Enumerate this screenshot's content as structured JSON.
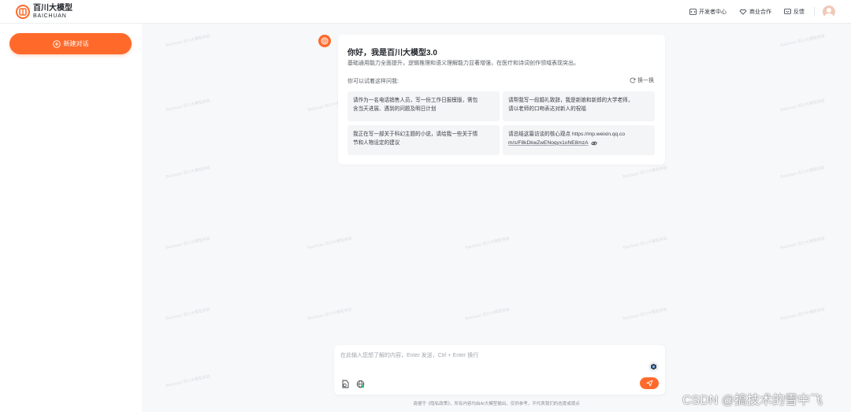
{
  "header": {
    "logo_cn": "百川大模型",
    "logo_en": "BAICHUAN",
    "links": [
      {
        "label": "开发者中心",
        "icon": "code-icon"
      },
      {
        "label": "商业合作",
        "icon": "handshake-icon"
      },
      {
        "label": "反馈",
        "icon": "feedback-icon"
      }
    ]
  },
  "sidebar": {
    "new_chat_label": "新建对话"
  },
  "welcome": {
    "title": "你好，我是百川大模型3.0",
    "subtitle": "基础通用能力全面提升，逻辑推理和语义理解能力显著增强，在医疗和诗词创作领域表现突出。",
    "hint": "你可以试着这样问我:",
    "swap_label": "换一换",
    "suggestions": [
      {
        "line1": "请作为一名电话销售人员，写一份工作日报模版，需包",
        "line2": "含当天进展、遇到的问题及明日计划"
      },
      {
        "line1": "请帮我写一段婚礼致辞，我是新娘和新郎的大学老师，",
        "line2": "请以老师的口吻表达对新人的祝福"
      },
      {
        "line1": "我正在写一部关于科幻主题的小说，请给我一些关于情",
        "line2": "节和人物设定的建议"
      },
      {
        "line1": "请总结这篇访谈的核心观点 https://mp.weixin.qq.co",
        "line2": "m/s/F8kDkwZwENoqyx1oNE8mzA"
      }
    ]
  },
  "input": {
    "placeholder": "在此输入您想了解的内容，Enter 发送，Ctrl + Enter 换行"
  },
  "footer": {
    "note": "请遵守《隐私政策》，所有内容均由AI大模型输出，仅供参考，不代表我们的态度或观点"
  },
  "watermark_text": "Baichuan 百川大模型体验",
  "overlay": {
    "csdn": "CSDN @搞技术的雪中飞"
  },
  "colors": {
    "accent": "#ff6a2b",
    "background": "#f7f8fa",
    "card": "#ffffff"
  }
}
